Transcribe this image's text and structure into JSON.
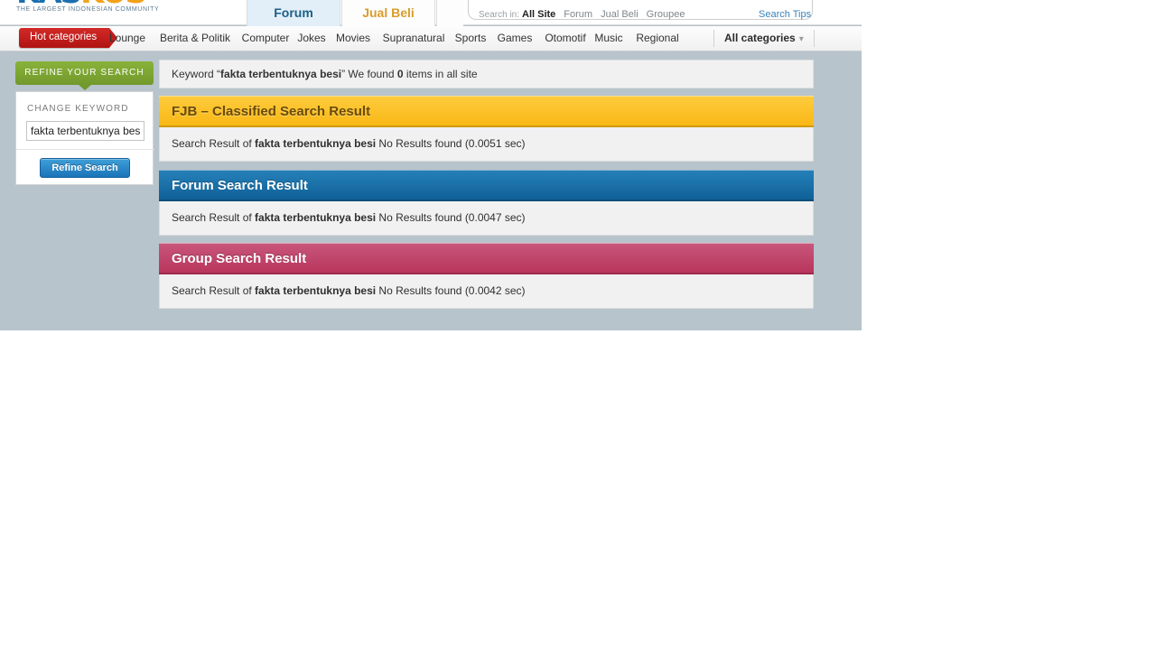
{
  "site": {
    "logo_text_part1": "KAS",
    "logo_text_part2": "KUS",
    "tagline": "THE LARGEST INDONESIAN COMMUNITY"
  },
  "header": {
    "tabs": [
      {
        "label": "Forum",
        "active": true
      },
      {
        "label": "Jual Beli",
        "active": false
      }
    ],
    "search": {
      "search_in_label": "Search in:",
      "scopes": [
        "All Site",
        "Forum",
        "Jual Beli",
        "Groupee"
      ],
      "selected_scope": "All Site",
      "tips_label": "Search Tips"
    }
  },
  "nav": {
    "hot_categories_label": "Hot categories",
    "items": [
      "Lounge",
      "Berita & Politik",
      "Computer",
      "Jokes",
      "Movies",
      "Supranatural",
      "Sports",
      "Games",
      "Otomotif",
      "Music",
      "Regional"
    ],
    "all_categories_label": "All categories",
    "all_categories_caret": "▾"
  },
  "sidebar": {
    "refine_tab_label": "REFINE YOUR SEARCH",
    "change_keyword_label": "CHANGE KEYWORD",
    "keyword_value": "fakta terbentuknya besi",
    "keyword_placeholder": "fakta terbentuknya besi",
    "refine_button_label": "Refine Search"
  },
  "main": {
    "keyword_bar": {
      "prefix": "Keyword “",
      "keyword": "fakta terbentuknya besi",
      "middle": "” We found ",
      "count": "0",
      "suffix": " items in all site"
    },
    "panels": [
      {
        "title": "FJB – Classified Search Result",
        "result_prefix": "Search Result of ",
        "result_keyword": "fakta terbentuknya besi",
        "result_suffix": " No Results found (0.0051 sec)",
        "color": "#f9b816"
      },
      {
        "title": "Forum Search Result",
        "result_prefix": "Search Result of ",
        "result_keyword": "fakta terbentuknya besi",
        "result_suffix": " No Results found (0.0047 sec)",
        "color": "#0f6197"
      },
      {
        "title": "Group Search Result",
        "result_prefix": "Search Result of ",
        "result_keyword": "fakta terbentuknya besi",
        "result_suffix": " No Results found (0.0042 sec)",
        "color": "#b9365c"
      }
    ]
  },
  "colors": {
    "page_background": "#b7c4cc",
    "fjb_header": "#f9b816",
    "forum_header": "#0f6197",
    "group_header": "#b9365c",
    "refine_tab": "#7da533",
    "hot_categories": "#bd1c1a",
    "button_blue": "#1a74b8"
  }
}
